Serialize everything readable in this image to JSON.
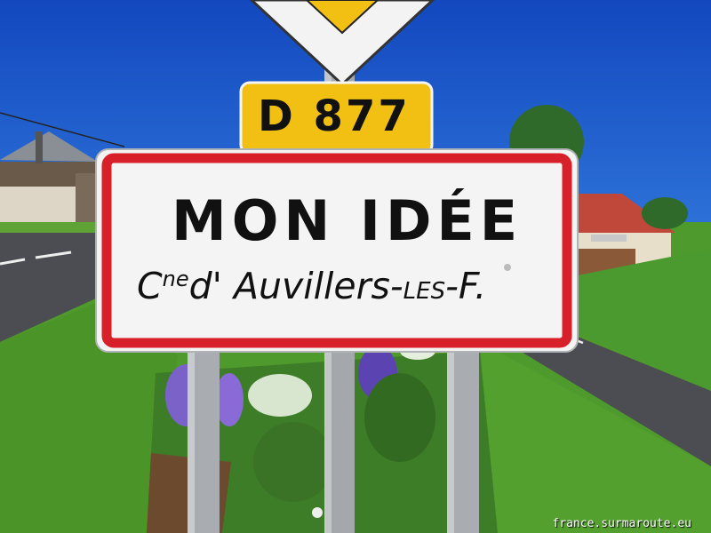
{
  "route_plate": {
    "text": "D 877"
  },
  "town_sign": {
    "name": "MON IDÉE",
    "sub_prefix": "C",
    "sub_sup": "ne",
    "sub_main": "d' Auvillers-",
    "sub_small": "LES",
    "sub_end": "-F."
  },
  "watermark": "france.surmaroute.eu",
  "colors": {
    "sky": "#1a56c8",
    "grass": "#4f9a2c",
    "road": "#4b4d52",
    "sign_border": "#d8202a",
    "sign_face": "#f4f4f4",
    "route_plate": "#f2c012",
    "roof_tiles": "#c0483b"
  }
}
